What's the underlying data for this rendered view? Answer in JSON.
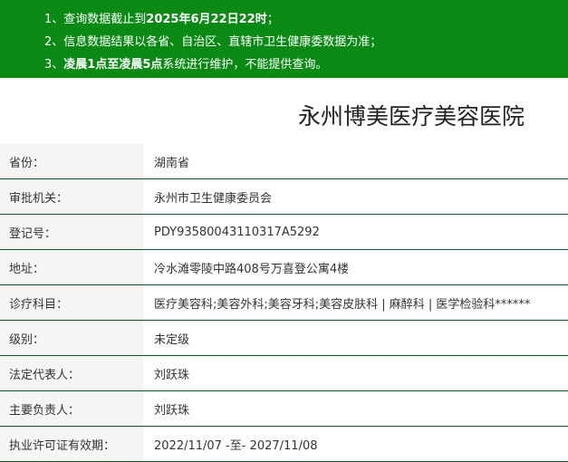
{
  "notice": {
    "line1_prefix": "1、查询数据截止到",
    "line1_bold": "2025年6月22日22时",
    "line1_suffix": "；",
    "line2": "2、信息数据结果以各省、自治区、直辖市卫生健康委数据为准；",
    "line3_prefix": "3、",
    "line3_bold": "凌晨1点至凌晨5点",
    "line3_suffix": "系统进行维护，不能提供查询。"
  },
  "hospital": {
    "name": "永州博美医疗美容医院"
  },
  "rows": [
    {
      "label": "省份：",
      "value": "湖南省"
    },
    {
      "label": "审批机关：",
      "value": "永州市卫生健康委员会"
    },
    {
      "label": "登记号：",
      "value": "PDY93580043110317A5292"
    },
    {
      "label": "地址：",
      "value": "冷水滩零陵中路408号万喜登公寓4楼"
    },
    {
      "label": "诊疗科目：",
      "value": "医疗美容科;美容外科;美容牙科;美容皮肤科 | 麻醉科 | 医学检验科******"
    },
    {
      "label": "级别：",
      "value": "未定级"
    },
    {
      "label": "法定代表人：",
      "value": "刘跃珠"
    },
    {
      "label": "主要负责人：",
      "value": "刘跃珠"
    },
    {
      "label": "执业许可证有效期：",
      "value": "2022/11/07 -至- 2027/11/08"
    }
  ]
}
